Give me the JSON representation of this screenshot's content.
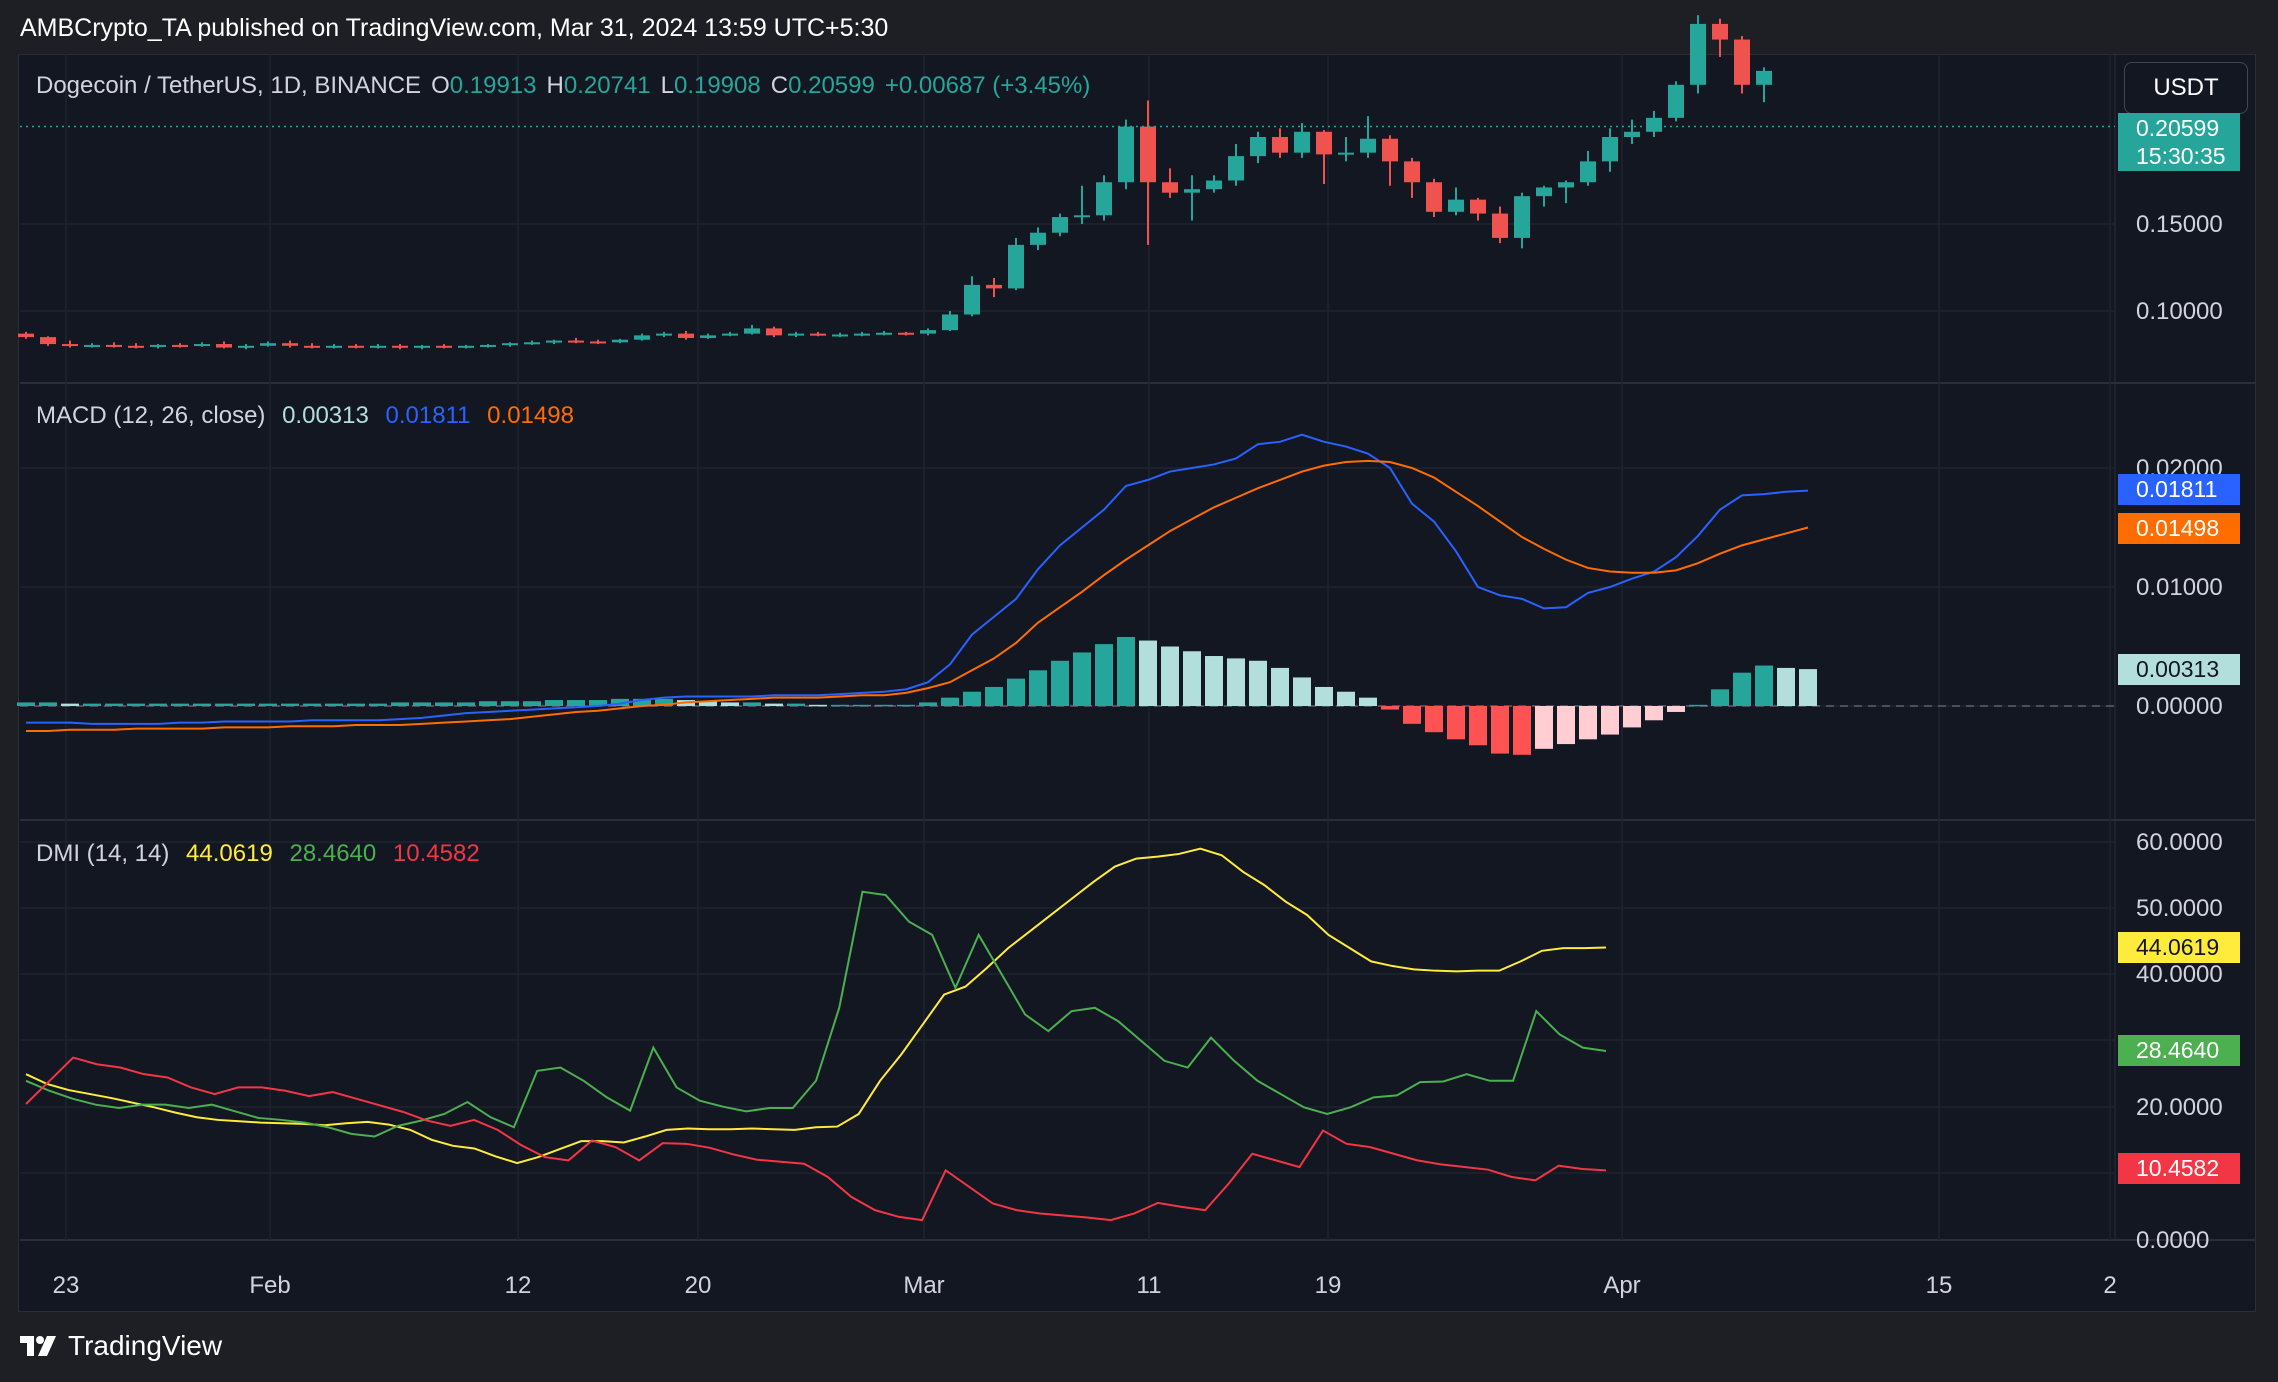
{
  "header": {
    "publisher_line": "AMBCrypto_TA published on TradingView.com, Mar 31, 2024 13:59 UTC+5:30"
  },
  "colors": {
    "background": "#131722",
    "up": "#26a69a",
    "down": "#ef5350",
    "macd_line": "#2962ff",
    "signal_line": "#ff6d00",
    "adx": "#ffeb3b",
    "plus_di": "#4caf50",
    "minus_di": "#f23645",
    "hist_up_strong": "#26a69a",
    "hist_up_weak": "#b2dfdb",
    "hist_down_strong": "#ff5252",
    "hist_down_weak": "#ffcdd2"
  },
  "toolbar": {
    "currency": "USDT"
  },
  "price_pane": {
    "symbol": "Dogecoin / TetherUS, 1D, BINANCE",
    "o_label": "O",
    "o_value": "0.19913",
    "h_label": "H",
    "h_value": "0.20741",
    "l_label": "L",
    "l_value": "0.19908",
    "c_label": "C",
    "c_value": "0.20599",
    "change": "+0.00687 (+3.45%)",
    "last_price": "0.20599",
    "countdown": "15:30:35",
    "axis_ticks": [
      "0.15000",
      "0.10000"
    ]
  },
  "macd_pane": {
    "title": "MACD (12, 26, close)",
    "hist_value": "0.00313",
    "macd_value": "0.01811",
    "signal_value": "0.01498",
    "axis_ticks": [
      "0.02000",
      "0.01000",
      "0.00000"
    ]
  },
  "dmi_pane": {
    "title": "DMI (14, 14)",
    "adx_value": "44.0619",
    "plus_di_value": "28.4640",
    "minus_di_value": "10.4582",
    "axis_ticks": [
      "60.0000",
      "50.0000",
      "40.0000",
      "20.0000",
      "0.0000"
    ]
  },
  "x_axis": {
    "ticks": [
      "23",
      "Feb",
      "12",
      "20",
      "Mar",
      "11",
      "19",
      "Apr",
      "15",
      "2"
    ]
  },
  "footer": {
    "brand": "TradingView"
  },
  "chart_data": [
    {
      "type": "candlestick",
      "title": "Dogecoin / TetherUS, 1D, BINANCE",
      "ylim": [
        0.05,
        0.23
      ],
      "candles": [
        [
          0.087,
          0.088,
          0.084,
          0.085
        ],
        [
          0.085,
          0.0855,
          0.08,
          0.081
        ],
        [
          0.081,
          0.083,
          0.079,
          0.08
        ],
        [
          0.08,
          0.0815,
          0.079,
          0.0805
        ],
        [
          0.0805,
          0.082,
          0.079,
          0.08
        ],
        [
          0.08,
          0.0815,
          0.0785,
          0.0795
        ],
        [
          0.0795,
          0.081,
          0.0785,
          0.0805
        ],
        [
          0.0805,
          0.0815,
          0.079,
          0.08
        ],
        [
          0.08,
          0.082,
          0.0795,
          0.081
        ],
        [
          0.081,
          0.0825,
          0.0785,
          0.079
        ],
        [
          0.079,
          0.081,
          0.078,
          0.08
        ],
        [
          0.08,
          0.0825,
          0.0795,
          0.0815
        ],
        [
          0.0815,
          0.083,
          0.079,
          0.08
        ],
        [
          0.08,
          0.0815,
          0.0785,
          0.0795
        ],
        [
          0.0795,
          0.081,
          0.0785,
          0.08
        ],
        [
          0.08,
          0.081,
          0.0785,
          0.0795
        ],
        [
          0.0795,
          0.081,
          0.0785,
          0.08
        ],
        [
          0.08,
          0.081,
          0.078,
          0.079
        ],
        [
          0.079,
          0.0805,
          0.078,
          0.08
        ],
        [
          0.08,
          0.081,
          0.0785,
          0.0795
        ],
        [
          0.0795,
          0.0805,
          0.0785,
          0.08
        ],
        [
          0.08,
          0.081,
          0.079,
          0.0805
        ],
        [
          0.0805,
          0.082,
          0.0795,
          0.0815
        ],
        [
          0.0815,
          0.083,
          0.0805,
          0.082
        ],
        [
          0.082,
          0.0835,
          0.081,
          0.083
        ],
        [
          0.083,
          0.0845,
          0.0815,
          0.0825
        ],
        [
          0.0825,
          0.0835,
          0.081,
          0.082
        ],
        [
          0.082,
          0.084,
          0.0815,
          0.0835
        ],
        [
          0.0835,
          0.087,
          0.083,
          0.086
        ],
        [
          0.086,
          0.088,
          0.085,
          0.087
        ],
        [
          0.087,
          0.0885,
          0.0835,
          0.0845
        ],
        [
          0.0845,
          0.087,
          0.084,
          0.086
        ],
        [
          0.086,
          0.088,
          0.0855,
          0.087
        ],
        [
          0.087,
          0.092,
          0.0865,
          0.09
        ],
        [
          0.09,
          0.091,
          0.085,
          0.086
        ],
        [
          0.086,
          0.088,
          0.085,
          0.087
        ],
        [
          0.087,
          0.088,
          0.0855,
          0.086
        ],
        [
          0.086,
          0.0875,
          0.085,
          0.0865
        ],
        [
          0.0865,
          0.088,
          0.0855,
          0.087
        ],
        [
          0.087,
          0.0885,
          0.086,
          0.0875
        ],
        [
          0.0875,
          0.088,
          0.086,
          0.087
        ],
        [
          0.087,
          0.09,
          0.086,
          0.089
        ],
        [
          0.089,
          0.1,
          0.0885,
          0.098
        ],
        [
          0.098,
          0.12,
          0.097,
          0.115
        ],
        [
          0.115,
          0.119,
          0.108,
          0.113
        ],
        [
          0.113,
          0.142,
          0.112,
          0.138
        ],
        [
          0.138,
          0.148,
          0.135,
          0.145
        ],
        [
          0.145,
          0.156,
          0.143,
          0.154
        ],
        [
          0.154,
          0.172,
          0.15,
          0.155
        ],
        [
          0.155,
          0.178,
          0.152,
          0.174
        ],
        [
          0.174,
          0.21,
          0.17,
          0.206
        ],
        [
          0.206,
          0.221,
          0.138,
          0.174
        ],
        [
          0.174,
          0.182,
          0.165,
          0.168
        ],
        [
          0.168,
          0.178,
          0.152,
          0.17
        ],
        [
          0.17,
          0.178,
          0.168,
          0.175
        ],
        [
          0.175,
          0.196,
          0.172,
          0.189
        ],
        [
          0.189,
          0.203,
          0.185,
          0.2
        ],
        [
          0.2,
          0.205,
          0.188,
          0.191
        ],
        [
          0.191,
          0.208,
          0.188,
          0.203
        ],
        [
          0.203,
          0.204,
          0.173,
          0.19
        ],
        [
          0.19,
          0.2,
          0.186,
          0.191
        ],
        [
          0.191,
          0.212,
          0.188,
          0.199
        ],
        [
          0.199,
          0.201,
          0.172,
          0.186
        ],
        [
          0.186,
          0.188,
          0.165,
          0.174
        ],
        [
          0.174,
          0.176,
          0.154,
          0.157
        ],
        [
          0.157,
          0.171,
          0.155,
          0.164
        ],
        [
          0.164,
          0.165,
          0.152,
          0.156
        ],
        [
          0.156,
          0.16,
          0.139,
          0.142
        ],
        [
          0.142,
          0.168,
          0.136,
          0.166
        ],
        [
          0.166,
          0.172,
          0.16,
          0.171
        ],
        [
          0.171,
          0.175,
          0.162,
          0.174
        ],
        [
          0.174,
          0.192,
          0.172,
          0.186
        ],
        [
          0.186,
          0.205,
          0.18,
          0.2
        ],
        [
          0.2,
          0.21,
          0.196,
          0.203
        ],
        [
          0.203,
          0.215,
          0.2,
          0.211
        ],
        [
          0.211,
          0.232,
          0.209,
          0.23
        ],
        [
          0.23,
          0.27,
          0.225,
          0.265
        ],
        [
          0.265,
          0.268,
          0.246,
          0.256
        ],
        [
          0.256,
          0.258,
          0.225,
          0.23
        ],
        [
          0.23,
          0.24,
          0.22,
          0.238
        ]
      ]
    },
    {
      "type": "line",
      "title": "MACD (12, 26, close)",
      "ylim": [
        -0.0095,
        0.0255
      ],
      "series": [
        {
          "name": "histogram",
          "values": [
            0.0003,
            0.0003,
            0.0002,
            0.0002,
            0.0002,
            0.0002,
            0.0002,
            0.0002,
            0.0002,
            0.0002,
            0.0002,
            0.0002,
            0.0002,
            0.0002,
            0.0002,
            0.0002,
            0.0002,
            0.0003,
            0.0003,
            0.0003,
            0.0003,
            0.0004,
            0.0004,
            0.0004,
            0.0005,
            0.0005,
            0.0005,
            0.0006,
            0.0006,
            0.0006,
            0.0005,
            0.0004,
            0.0003,
            0.0003,
            0.0002,
            0.0002,
            0.0001,
            0.0001,
            0.0001,
            0.0001,
            0.0001,
            0.0003,
            0.0007,
            0.0012,
            0.0016,
            0.0023,
            0.003,
            0.0038,
            0.0045,
            0.0052,
            0.0058,
            0.0055,
            0.005,
            0.0046,
            0.0042,
            0.004,
            0.0038,
            0.0032,
            0.0024,
            0.0016,
            0.0012,
            0.0007,
            -0.0003,
            -0.0015,
            -0.0022,
            -0.0028,
            -0.0033,
            -0.004,
            -0.0041,
            -0.0036,
            -0.0032,
            -0.0028,
            -0.0024,
            -0.0018,
            -0.0012,
            -0.0005,
            0.0001,
            0.0014,
            0.0028,
            0.0034,
            0.0032,
            0.0031
          ]
        },
        {
          "name": "macd",
          "values": [
            -0.0014,
            -0.0014,
            -0.0014,
            -0.0015,
            -0.0015,
            -0.0015,
            -0.0015,
            -0.0014,
            -0.0014,
            -0.0013,
            -0.0013,
            -0.0013,
            -0.0013,
            -0.0012,
            -0.0012,
            -0.0012,
            -0.0012,
            -0.0011,
            -0.001,
            -0.0008,
            -0.0006,
            -0.0005,
            -0.0004,
            -0.0003,
            -0.0002,
            -0.0001,
            0.0,
            0.0002,
            0.0005,
            0.0007,
            0.0008,
            0.0008,
            0.0008,
            0.0008,
            0.0009,
            0.0009,
            0.0009,
            0.001,
            0.0011,
            0.0012,
            0.0014,
            0.002,
            0.0035,
            0.006,
            0.0075,
            0.009,
            0.0115,
            0.0135,
            0.015,
            0.0165,
            0.0185,
            0.019,
            0.0197,
            0.02,
            0.0203,
            0.0208,
            0.022,
            0.0222,
            0.0228,
            0.0222,
            0.0218,
            0.0212,
            0.02,
            0.017,
            0.0155,
            0.013,
            0.01,
            0.0093,
            0.009,
            0.0082,
            0.0083,
            0.0095,
            0.01,
            0.0107,
            0.0113,
            0.0125,
            0.0143,
            0.0165,
            0.0177,
            0.0178,
            0.018,
            0.0181
          ]
        },
        {
          "name": "signal",
          "values": [
            -0.0021,
            -0.0021,
            -0.002,
            -0.002,
            -0.002,
            -0.0019,
            -0.0019,
            -0.0019,
            -0.0019,
            -0.0018,
            -0.0018,
            -0.0018,
            -0.0017,
            -0.0017,
            -0.0017,
            -0.0016,
            -0.0016,
            -0.0016,
            -0.0015,
            -0.0014,
            -0.0013,
            -0.0012,
            -0.0011,
            -0.0009,
            -0.0007,
            -0.0005,
            -0.0004,
            -0.0002,
            0.0,
            0.0001,
            0.0003,
            0.0004,
            0.0005,
            0.0006,
            0.0007,
            0.0007,
            0.0007,
            0.0008,
            0.0009,
            0.0009,
            0.0011,
            0.0015,
            0.002,
            0.003,
            0.004,
            0.0053,
            0.007,
            0.0083,
            0.0096,
            0.011,
            0.0123,
            0.0135,
            0.0147,
            0.0157,
            0.0167,
            0.0175,
            0.0183,
            0.019,
            0.0197,
            0.0202,
            0.0205,
            0.0206,
            0.0205,
            0.02,
            0.0192,
            0.018,
            0.0168,
            0.0155,
            0.0142,
            0.0132,
            0.0123,
            0.0116,
            0.0113,
            0.0112,
            0.0112,
            0.0114,
            0.012,
            0.0128,
            0.0135,
            0.014,
            0.0145,
            0.015
          ]
        }
      ]
    },
    {
      "type": "line",
      "title": "DMI (14, 14)",
      "ylim": [
        0,
        60
      ],
      "series": [
        {
          "name": "adx",
          "values": [
            25.0,
            23.5,
            22.6,
            22.0,
            21.4,
            20.7,
            20.0,
            19.2,
            18.5,
            18.1,
            17.9,
            17.7,
            17.6,
            17.5,
            17.3,
            17.6,
            17.8,
            17.4,
            16.6,
            15.1,
            14.2,
            13.8,
            12.6,
            11.6,
            12.5,
            13.7,
            14.9,
            14.9,
            14.7,
            15.6,
            16.6,
            16.8,
            16.7,
            16.7,
            16.8,
            16.7,
            16.6,
            17.0,
            17.1,
            19.0,
            24.0,
            28.0,
            32.5,
            37.0,
            38.2,
            41.0,
            44.0,
            46.5,
            49.0,
            51.5,
            54.0,
            56.3,
            57.5,
            57.8,
            58.2,
            59.0,
            58.0,
            55.5,
            53.5,
            51.0,
            49.0,
            46.0,
            44.0,
            42.0,
            41.3,
            40.8,
            40.6,
            40.5,
            40.6,
            40.6,
            42.0,
            43.6,
            44.0,
            44.0,
            44.1
          ]
        },
        {
          "name": "plus_di",
          "values": [
            24.0,
            22.5,
            21.3,
            20.4,
            19.9,
            20.4,
            20.4,
            19.9,
            20.4,
            19.4,
            18.4,
            18.1,
            17.7,
            17.0,
            16.0,
            15.6,
            17.2,
            18.0,
            19.0,
            20.8,
            18.5,
            17.0,
            25.5,
            26.0,
            24.0,
            21.5,
            19.5,
            29.0,
            23.0,
            21.0,
            20.1,
            19.4,
            19.9,
            19.9,
            24.0,
            35.0,
            52.5,
            52.0,
            48.0,
            46.0,
            38.0,
            46.0,
            40.0,
            34.0,
            31.5,
            34.5,
            35.0,
            33.0,
            30.0,
            27.0,
            26.0,
            30.5,
            27.0,
            24.0,
            22.0,
            20.0,
            19.0,
            20.0,
            21.5,
            21.8,
            23.8,
            23.9,
            25.0,
            24.0,
            24.0,
            34.5,
            31.0,
            29.0,
            28.5
          ]
        },
        {
          "name": "minus_di",
          "values": [
            20.5,
            24.0,
            27.5,
            26.5,
            26.0,
            25.0,
            24.5,
            23.0,
            22.0,
            23.0,
            23.0,
            22.5,
            21.7,
            22.3,
            21.3,
            20.3,
            19.3,
            18.0,
            17.2,
            18.1,
            16.6,
            14.3,
            12.5,
            12.0,
            15.0,
            14.0,
            12.0,
            14.6,
            14.5,
            13.9,
            12.9,
            12.1,
            11.8,
            11.5,
            9.5,
            6.5,
            4.5,
            3.5,
            3.0,
            10.5,
            8.0,
            5.5,
            4.5,
            4.0,
            3.7,
            3.4,
            3.0,
            4.0,
            5.6,
            5.0,
            4.5,
            8.5,
            13.0,
            12.0,
            11.0,
            16.5,
            14.5,
            14.0,
            13.0,
            12.0,
            11.4,
            11.0,
            10.6,
            9.5,
            9.0,
            11.2,
            10.7,
            10.5
          ]
        }
      ]
    }
  ]
}
